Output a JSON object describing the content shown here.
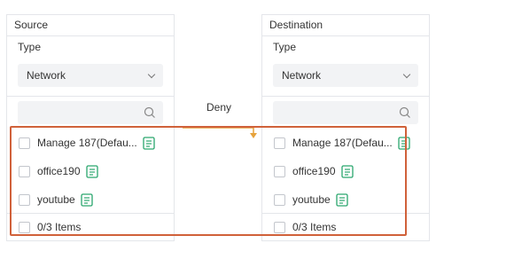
{
  "source": {
    "title": "Source",
    "type_label": "Type",
    "type_value": "Network",
    "items": [
      {
        "label": "Manage 187(Defau..."
      },
      {
        "label": "office190"
      },
      {
        "label": "youtube"
      }
    ],
    "footer": "0/3 Items"
  },
  "destination": {
    "title": "Destination",
    "type_label": "Type",
    "type_value": "Network",
    "items": [
      {
        "label": "Manage 187(Defau..."
      },
      {
        "label": "office190"
      },
      {
        "label": "youtube"
      }
    ],
    "footer": "0/3 Items"
  },
  "action": {
    "label": "Deny"
  },
  "colors": {
    "highlight": "#d0613a",
    "arrow": "#e6a23c",
    "doc_icon": "#2aa66e"
  },
  "icons": {
    "search": "search-icon",
    "details": "document-icon",
    "dropdown": "chevron-down-icon"
  }
}
